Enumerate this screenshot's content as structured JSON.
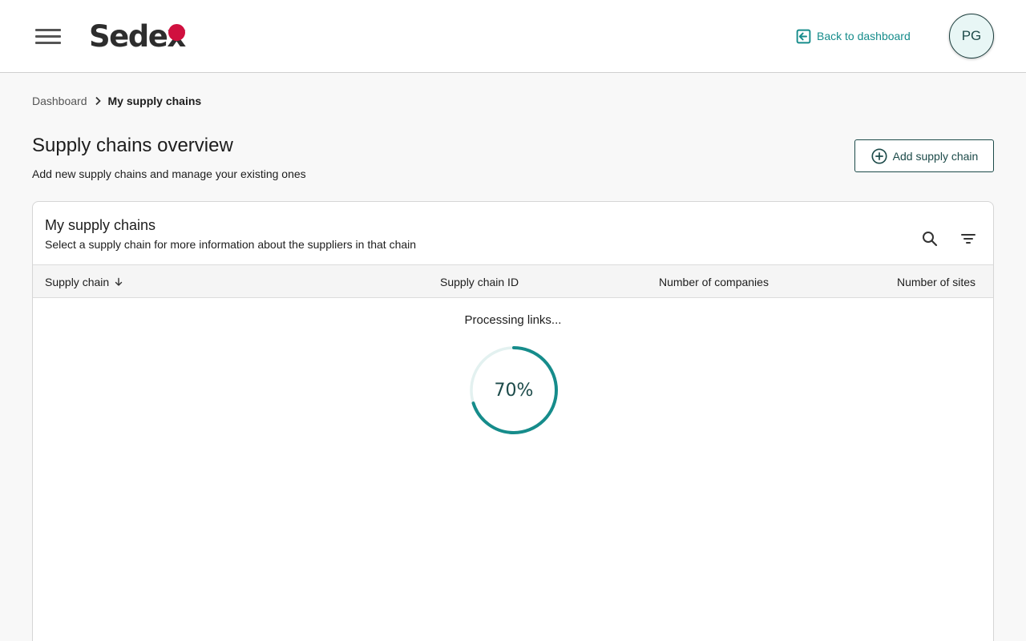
{
  "header": {
    "logo_text": "Sedex",
    "back_link_label": "Back to dashboard",
    "avatar_initials": "PG",
    "brand_color": "#d0103f",
    "accent_color": "#168c8b"
  },
  "breadcrumb": {
    "items": [
      "Dashboard",
      "My supply chains"
    ]
  },
  "page": {
    "title": "Supply chains overview",
    "subtitle": "Add new supply chains and manage your existing ones",
    "add_button_label": "Add supply chain"
  },
  "card": {
    "title": "My supply chains",
    "subtitle": "Select a supply chain for more information about the suppliers in that chain",
    "icons": [
      "search-icon",
      "filter-icon"
    ]
  },
  "table": {
    "columns": [
      "Supply chain",
      "Supply chain ID",
      "Number of companies",
      "Number of sites"
    ],
    "sort_column": "Supply chain",
    "sort_direction": "descending"
  },
  "loading": {
    "message": "Processing links...",
    "progress_percent": 70,
    "progress_label": "70%"
  }
}
